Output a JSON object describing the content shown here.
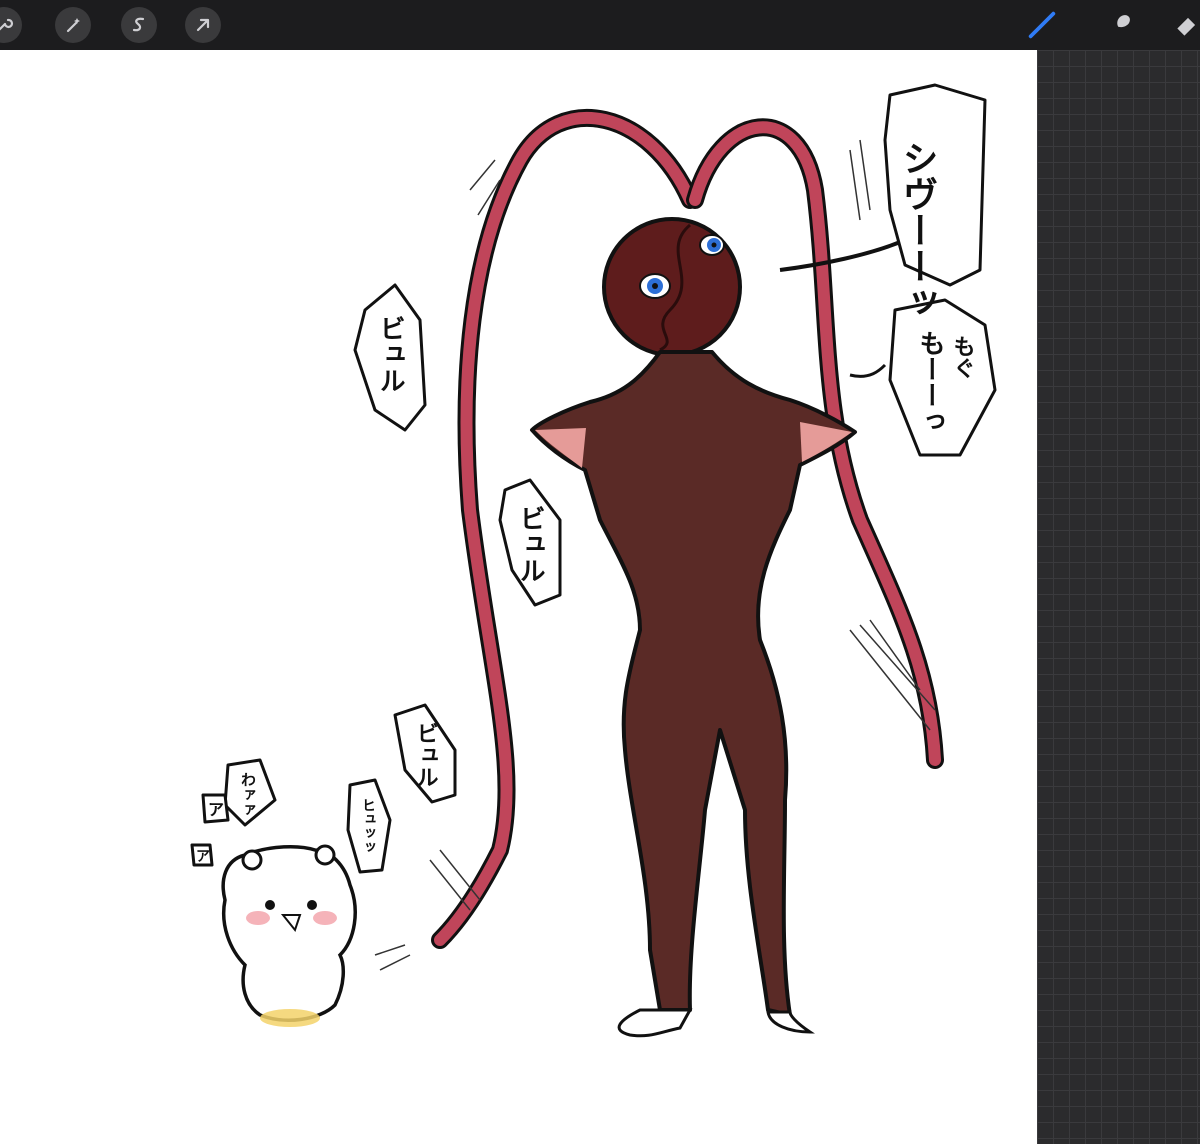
{
  "toolbar": {
    "left_buttons": [
      {
        "name": "wrench-icon",
        "label": "Actions"
      },
      {
        "name": "magic-wand-icon",
        "label": "Adjustments"
      },
      {
        "name": "selection-icon",
        "label": "Selection"
      },
      {
        "name": "arrow-cursor-icon",
        "label": "Transform"
      }
    ],
    "right_tools": [
      {
        "name": "brush-icon",
        "active": true
      },
      {
        "name": "smudge-icon",
        "active": false
      },
      {
        "name": "eraser-icon",
        "active": false
      }
    ],
    "accent_color": "#2f7bf5"
  },
  "artwork": {
    "sfx_top_right": "シヴーーッ",
    "sfx_mid_right_a": "もぐ",
    "sfx_mid_right_b": "もーーっ",
    "sfx_left_upper": "ビュル",
    "sfx_center": "ビュル",
    "sfx_lower": "ビュル",
    "sfx_hyu": "ヒュッッ",
    "sfx_wa": "わァァ",
    "sfx_a1": "ア",
    "sfx_a2": "ア",
    "colors": {
      "body": "#5a2a26",
      "tentacle": "#c0455a",
      "eye": "#2d6fd6",
      "blush": "#f2a0a8",
      "puddle": "#f3d26a"
    }
  }
}
